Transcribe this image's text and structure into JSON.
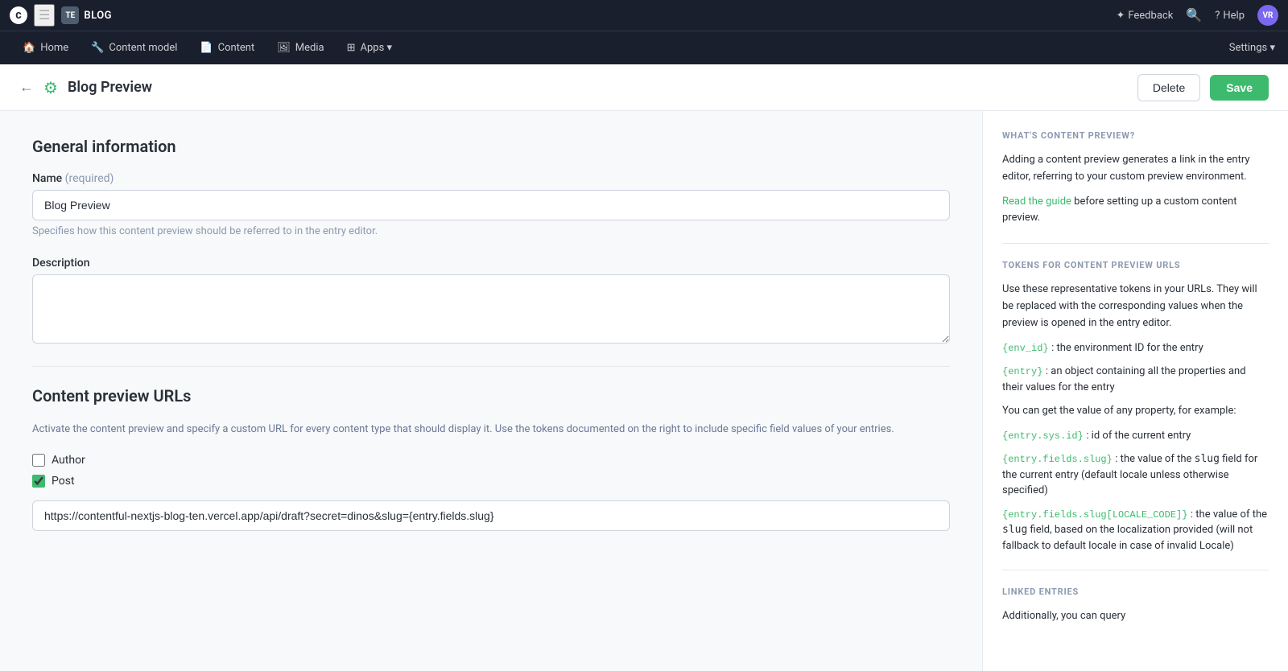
{
  "topbar": {
    "logo": "C",
    "hamburger": "☰",
    "space_avatar": "TE",
    "space_name": "BLOG",
    "feedback_label": "Feedback",
    "feedback_icon": "★",
    "help_label": "Help",
    "user_avatar": "VR"
  },
  "navbar": {
    "items": [
      {
        "id": "home",
        "label": "Home",
        "icon": "⌂"
      },
      {
        "id": "content-model",
        "label": "Content model",
        "icon": "⛏"
      },
      {
        "id": "content",
        "label": "Content",
        "icon": "◻"
      },
      {
        "id": "media",
        "label": "Media",
        "icon": "▣"
      },
      {
        "id": "apps",
        "label": "Apps ▾",
        "icon": "⊞"
      }
    ],
    "settings_label": "Settings ▾"
  },
  "page_header": {
    "back_icon": "←",
    "icon": "⚙",
    "title": "Blog Preview",
    "delete_label": "Delete",
    "save_label": "Save"
  },
  "form": {
    "general_title": "General information",
    "name_label": "Name",
    "name_required": "(required)",
    "name_value": "Blog Preview",
    "name_hint": "Specifies how this content preview should be referred to in the entry editor.",
    "description_label": "Description",
    "description_value": "",
    "description_placeholder": "",
    "urls_title": "Content preview URLs",
    "urls_subtitle": "Activate the content preview and specify a custom URL for every content type that should display it. Use the tokens documented on the right to include specific field values of your entries.",
    "checkboxes": [
      {
        "id": "author",
        "label": "Author",
        "checked": false
      },
      {
        "id": "post",
        "label": "Post",
        "checked": true
      }
    ],
    "url_value": "https://contentful-nextjs-blog-ten.vercel.app/api/draft?secret=dinos&slug={entry.fields.slug}"
  },
  "sidebar": {
    "whats_preview_title": "WHAT'S CONTENT PREVIEW?",
    "whats_preview_text1": "Adding a content preview generates a link in the entry editor, referring to your custom preview environment.",
    "whats_preview_link": "Read the guide",
    "whats_preview_text2": "before setting up a custom content preview.",
    "tokens_title": "TOKENS FOR CONTENT PREVIEW URLS",
    "tokens_desc": "Use these representative tokens in your URLs. They will be replaced with the corresponding values when the preview is opened in the entry editor.",
    "tokens": [
      {
        "token": "{env_id}",
        "desc": ": the environment ID for the entry"
      },
      {
        "token": "{entry}",
        "desc": ": an object containing all the properties and their values for the entry"
      },
      {
        "token_plain": "You can get the value of any property, for example:"
      },
      {
        "token": "{entry.sys.id}",
        "desc": ": id of the current entry"
      },
      {
        "token": "{entry.fields.slug}",
        "desc": ": the value of the slug field for the current entry (default locale unless otherwise specified)"
      },
      {
        "token": "{entry.fields.slug[LOCALE_CODE]}",
        "desc": ": the value of the slug field, based on the localization provided (will not fallback to default locale in case of invalid Locale)"
      }
    ],
    "linked_entries_title": "LINKED ENTRIES",
    "linked_entries_text": "Additionally, you can query"
  }
}
